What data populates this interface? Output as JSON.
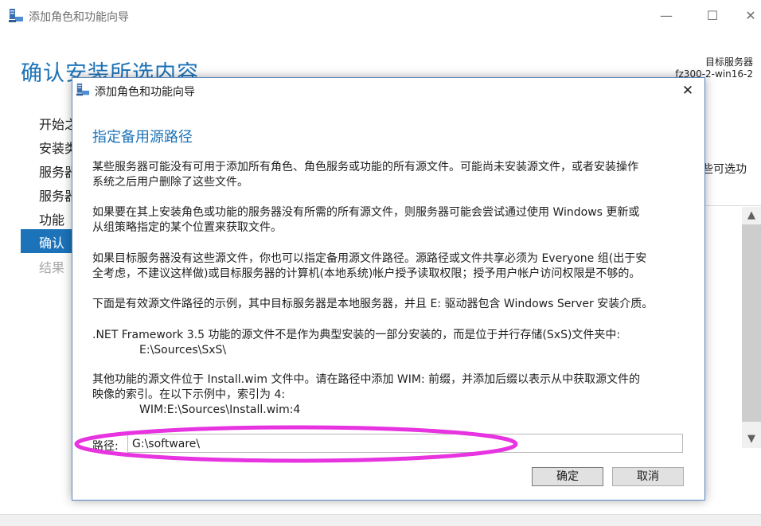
{
  "outer_window": {
    "title": "添加角色和功能向导",
    "heading": "确认安装所选内容",
    "target_label": "目标服务器",
    "target_name": "fz300-2-win16-2",
    "controls": {
      "minimize": "—",
      "maximize": "☐",
      "close": "✕"
    },
    "nav_items": [
      "开始之",
      "安装类",
      "服务器",
      "服务器",
      "功能",
      "确认",
      "结果"
    ],
    "side_text": "些可选功",
    "scrollbar": {
      "up": "▲",
      "down": "▼"
    }
  },
  "dialog": {
    "title": "添加角色和功能向导",
    "close": "✕",
    "heading": "指定备用源路径",
    "paragraphs": {
      "p1a": "某些服务器可能没有可用于添加所有角色、角色服务或功能的所有源文件。可能尚未安装源文件，或者安装操作",
      "p1b": "系统之后用户删除了这些文件。",
      "p2a": "如果要在其上安装角色或功能的服务器没有所需的所有源文件，则服务器可能会尝试通过使用 Windows 更新或",
      "p2b": "从组策略指定的某个位置来获取文件。",
      "p3a": "如果目标服务器没有这些源文件，你也可以指定备用源文件路径。源路径或文件共享必须为 Everyone 组(出于安",
      "p3b": "全考虑，不建议这样做)或目标服务器的计算机(本地系统)帐户授予读取权限；授予用户帐户访问权限是不够的。",
      "p4": "下面是有效源文件路径的示例，其中目标服务器是本地服务器，并且 E: 驱动器包含 Windows Server 安装介质。",
      "p5a": ".NET Framework 3.5 功能的源文件不是作为典型安装的一部分安装的，而是位于并行存储(SxS)文件夹中:",
      "p5b": "E:\\Sources\\SxS\\",
      "p6a": "其他功能的源文件位于 Install.wim 文件中。请在路径中添加 WIM: 前缀，并添加后缀以表示从中获取源文件的",
      "p6b": "映像的索引。在以下示例中，索引为 4:",
      "p6c": "WIM:E:\\Sources\\Install.wim:4"
    },
    "path_label": "路径:",
    "path_value": "G:\\software\\",
    "ok_button": "确定",
    "cancel_button": "取消"
  },
  "colors": {
    "accent": "#1c73b9",
    "highlight_ellipse": "#e733e0"
  },
  "icons": [
    "server-manager-icon",
    "close-icon",
    "minimize-icon",
    "maximize-icon",
    "scroll-up-icon",
    "scroll-down-icon"
  ]
}
